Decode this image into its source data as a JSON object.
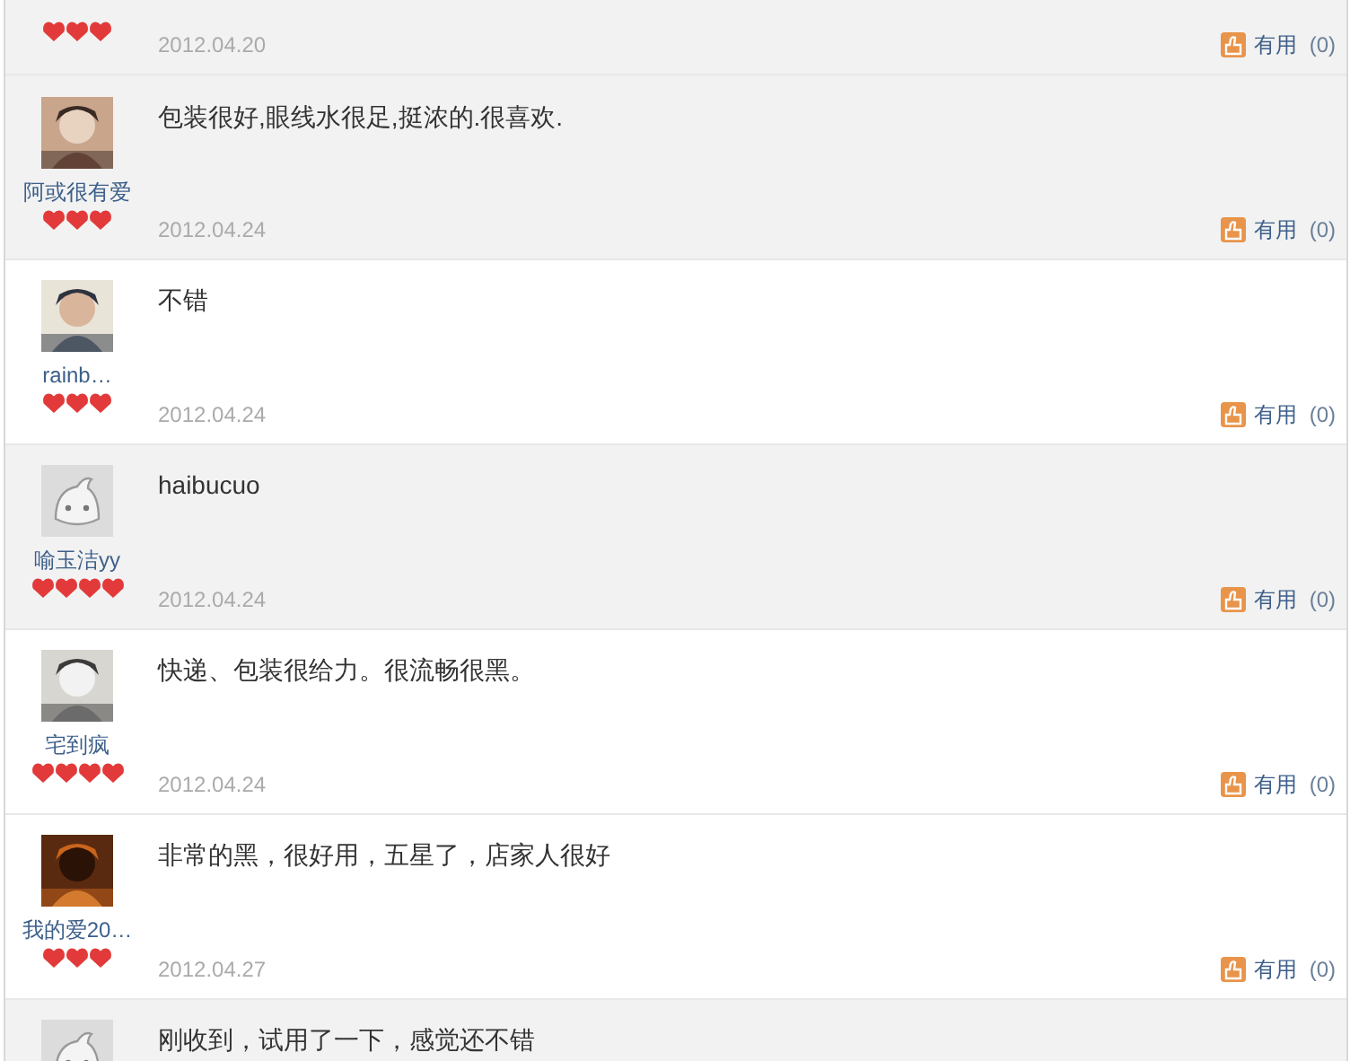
{
  "reviews": [
    {
      "shaded": true,
      "stars": 3,
      "date": "2012.04.20",
      "useful_label": "有用",
      "useful_count": "(0)"
    },
    {
      "shaded": true,
      "name": "阿或很有爱",
      "stars": 3,
      "comment": "包装很好,眼线水很足,挺浓的.很喜欢.",
      "date": "2012.04.24",
      "useful_label": "有用",
      "useful_count": "(0)"
    },
    {
      "shaded": false,
      "name": "rainb…",
      "stars": 3,
      "comment": "不错",
      "date": "2012.04.24",
      "useful_label": "有用",
      "useful_count": "(0)"
    },
    {
      "shaded": true,
      "avatar": {
        "kind": "default"
      },
      "name": "喻玉洁yy",
      "stars": 4,
      "comment": "haibucuo",
      "date": "2012.04.24",
      "useful_label": "有用",
      "useful_count": "(0)"
    },
    {
      "shaded": false,
      "name": "宅到疯",
      "stars": 4,
      "comment": "快递、包装很给力。很流畅很黑。",
      "date": "2012.04.24",
      "useful_label": "有用",
      "useful_count": "(0)"
    },
    {
      "shaded": false,
      "name": "我的爱20…",
      "stars": 3,
      "comment": "非常的黑，很好用，五星了，店家人很好",
      "date": "2012.04.27",
      "useful_label": "有用",
      "useful_count": "(0)"
    },
    {
      "shaded": true,
      "avatar": {
        "kind": "default"
      },
      "comment": "刚收到，试用了一下，感觉还不错"
    }
  ]
}
